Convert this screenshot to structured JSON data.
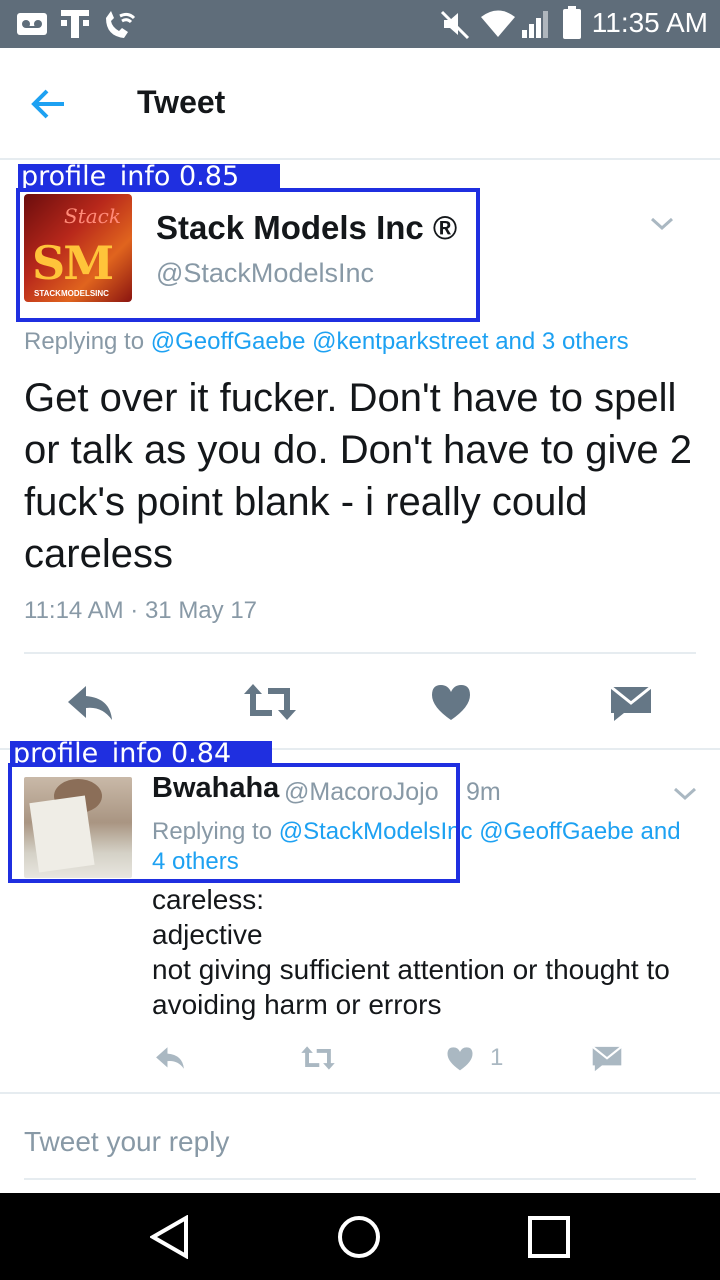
{
  "status_bar": {
    "time": "11:35 AM",
    "icons": [
      "voicemail-icon",
      "t-mobile-icon",
      "wifi-calling-icon",
      "mute-icon",
      "wifi-icon",
      "signal-icon",
      "battery-icon"
    ]
  },
  "header": {
    "title": "Tweet",
    "back_icon": "arrow-left-icon"
  },
  "detections": [
    {
      "label": "profile_info 0.85"
    },
    {
      "label": "profile_info 0.84"
    }
  ],
  "main_tweet": {
    "name": "Stack Models Inc ®",
    "handle": "@StackModelsInc",
    "avatar_text": {
      "script": "Stack",
      "mono": "SM",
      "caption": "STACKMODELSINC"
    },
    "replying_prefix": "Replying to",
    "replying_links": "@GeoffGaebe @kentparkstreet and 3 others",
    "text": "Get over it fucker. Don't have to spell or talk as you do. Don't have to give 2 fuck's point blank - i really could careless",
    "timestamp": "11:14 AM · 31 May 17",
    "actions": [
      "reply-icon",
      "retweet-icon",
      "like-icon",
      "direct-message-icon"
    ]
  },
  "reply_tweet": {
    "name": "Bwahaha",
    "handle": "@MacoroJojo",
    "age": "9m",
    "replying_prefix": "Replying to",
    "replying_links": "@StackModelsInc @GeoffGaebe and 4 others",
    "text_lines": [
      "careless:",
      "adjective",
      "not giving sufficient attention or thought to avoiding harm or errors"
    ],
    "like_count": "1"
  },
  "compose": {
    "placeholder": "Tweet your reply"
  },
  "colors": {
    "accent": "#1da1f2",
    "status_bar": "#5f6d7a",
    "detection_box": "#1f2fe0",
    "muted_text": "#8899a6"
  }
}
